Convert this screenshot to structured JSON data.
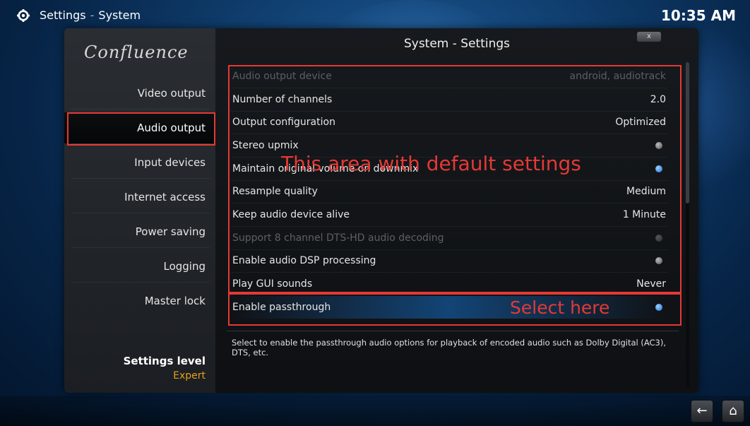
{
  "header": {
    "app_title": "Settings",
    "separator": "-",
    "section": "System",
    "clock": "10:35 AM"
  },
  "panel": {
    "logo": "Confluence",
    "title": "System - Settings",
    "close_label": "x"
  },
  "sidebar": {
    "items": [
      {
        "label": "Video output"
      },
      {
        "label": "Audio output"
      },
      {
        "label": "Input devices"
      },
      {
        "label": "Internet access"
      },
      {
        "label": "Power saving"
      },
      {
        "label": "Logging"
      },
      {
        "label": "Master lock"
      }
    ],
    "selected": "Audio output",
    "settings_level_label": "Settings level",
    "settings_level_value": "Expert"
  },
  "settings": [
    {
      "label": "Audio output device",
      "value": "android, audiotrack",
      "disabled": true
    },
    {
      "label": "Number of channels",
      "value": "2.0"
    },
    {
      "label": "Output configuration",
      "value": "Optimized"
    },
    {
      "label": "Stereo upmix",
      "toggle": "off"
    },
    {
      "label": "Maintain original volume on downmix",
      "toggle": "on"
    },
    {
      "label": "Resample quality",
      "value": "Medium"
    },
    {
      "label": "Keep audio device alive",
      "value": "1 Minute"
    },
    {
      "label": "Support 8 channel DTS-HD audio decoding",
      "toggle": "off",
      "disabled": true
    },
    {
      "label": "Enable audio DSP processing",
      "toggle": "off"
    },
    {
      "label": "Play GUI sounds",
      "value": "Never"
    },
    {
      "label": "Enable passthrough",
      "toggle": "on",
      "focused": true
    }
  ],
  "help_text": "Select to enable the passthrough audio options for playback of encoded audio such as Dolby Digital (AC3), DTS, etc.",
  "annotations": {
    "default_area": "This area with default settings",
    "select_here": "Select here",
    "color": "#e53935"
  },
  "footer": {
    "back_icon": "back-arrow-icon",
    "home_icon": "home-icon"
  }
}
